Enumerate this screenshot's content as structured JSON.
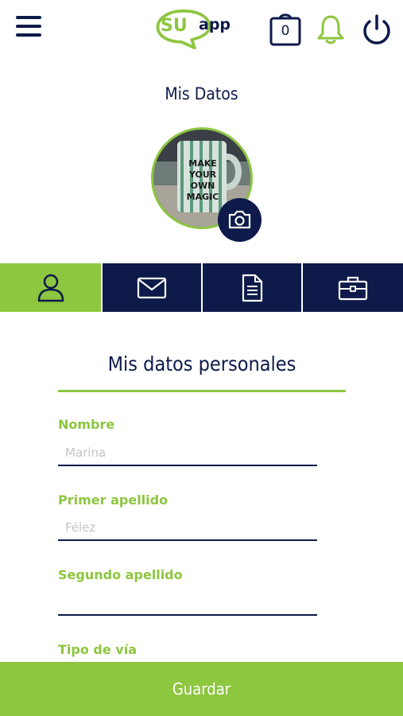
{
  "header": {
    "menu_icon": "hamburger-menu-icon",
    "logo": {
      "part1": "SU",
      "part2": "app"
    },
    "cart_count": "0",
    "cart_icon": "shopping-bag-icon",
    "bell_icon": "notification-bell-icon",
    "power_icon": "power-icon"
  },
  "page": {
    "title": "Mis Datos"
  },
  "avatar": {
    "photo_text": "MAKE YOUR OWN MAGIC",
    "camera_icon": "camera-icon"
  },
  "tabs": [
    {
      "icon": "user-icon",
      "active": true
    },
    {
      "icon": "envelope-icon",
      "active": false
    },
    {
      "icon": "document-icon",
      "active": false
    },
    {
      "icon": "briefcase-icon",
      "active": false
    }
  ],
  "form": {
    "section_title": "Mis datos personales",
    "fields": [
      {
        "label": "Nombre",
        "placeholder": "Marina",
        "value": ""
      },
      {
        "label": "Primer apellido",
        "placeholder": "Félez",
        "value": ""
      },
      {
        "label": "Segundo apellido",
        "placeholder": "",
        "value": ""
      },
      {
        "label": "Tipo de vía"
      }
    ]
  },
  "footer": {
    "save_label": "Guardar"
  },
  "colors": {
    "navy": "#0d1a4a",
    "green": "#8dc63f",
    "white": "#ffffff"
  }
}
